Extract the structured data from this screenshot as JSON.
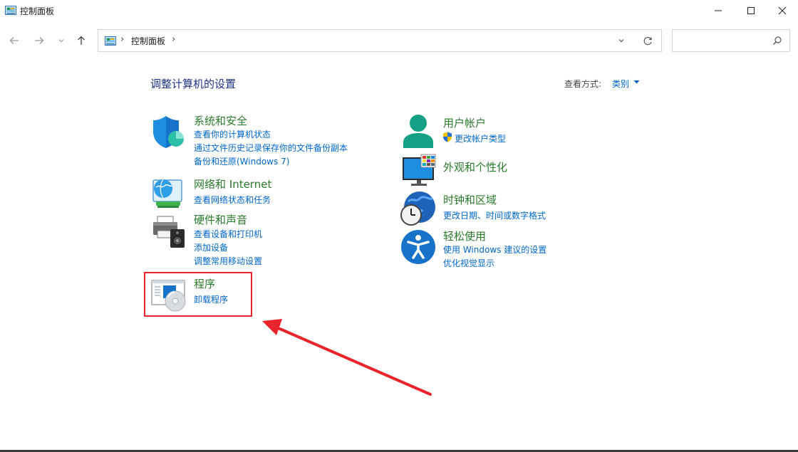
{
  "window": {
    "title": "控制面板",
    "icons": {
      "app": "control-panel-icon",
      "minimize": "minimize-icon",
      "maximize": "maximize-icon",
      "close": "close-icon"
    }
  },
  "nav": {
    "breadcrumb": [
      "控制面板"
    ],
    "search_placeholder": "",
    "icons": {
      "back": "arrow-left-icon",
      "forward": "arrow-right-icon",
      "recent": "chevron-down-icon",
      "up": "arrow-up-icon",
      "dropdown": "chevron-down-icon",
      "refresh": "refresh-icon",
      "search": "search-icon"
    }
  },
  "content": {
    "heading": "调整计算机的设置",
    "view_by_label": "查看方式:",
    "view_by_value": "类别",
    "left_categories": [
      {
        "title": "系统和安全",
        "icon": "shield-icon",
        "links": [
          "查看你的计算机状态",
          "通过文件历史记录保存你的文件备份副本",
          "备份和还原(Windows 7)"
        ]
      },
      {
        "title": "网络和 Internet",
        "icon": "network-globe-icon",
        "links": [
          "查看网络状态和任务"
        ]
      },
      {
        "title": "硬件和声音",
        "icon": "printer-speaker-icon",
        "links": [
          "查看设备和打印机",
          "添加设备",
          "调整常用移动设置"
        ]
      },
      {
        "title": "程序",
        "icon": "programs-disc-icon",
        "links": [
          "卸载程序"
        ]
      }
    ],
    "right_categories": [
      {
        "title": "用户帐户",
        "icon": "user-icon",
        "links": [
          "更改帐户类型"
        ],
        "link_icon": "uac-shield-icon"
      },
      {
        "title": "外观和个性化",
        "icon": "monitor-palette-icon",
        "links": []
      },
      {
        "title": "时钟和区域",
        "icon": "clock-globe-icon",
        "links": [
          "更改日期、时间或数字格式"
        ]
      },
      {
        "title": "轻松使用",
        "icon": "accessibility-icon",
        "links": [
          "使用 Windows 建议的设置",
          "优化视觉显示"
        ]
      }
    ]
  },
  "annotation": {
    "color": "#e8242a"
  },
  "colors": {
    "heading": "#1e3287",
    "category_title": "#2a7a2a",
    "link": "#0066cc"
  }
}
